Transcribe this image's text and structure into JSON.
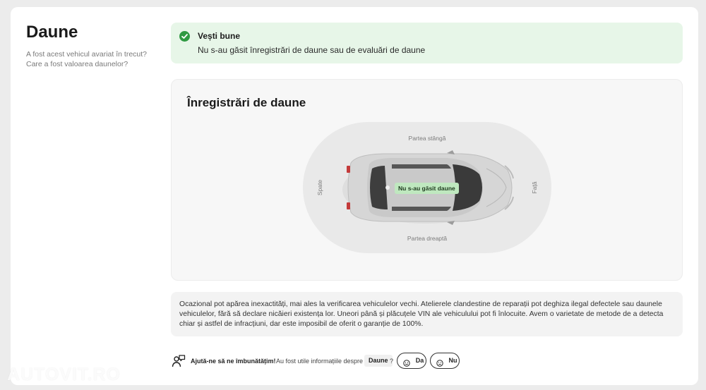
{
  "sidebar": {
    "title": "Daune",
    "subtitle": "A fost acest vehicul avariat în trecut? Care a fost valoarea daunelor?"
  },
  "good_news": {
    "title": "Vești bune",
    "text": "Nu s-au găsit înregistrări de daune sau de evaluări de daune",
    "icon": "check-circle-icon",
    "accent_color": "#2f9a42",
    "background_color": "#e7f6e8"
  },
  "records": {
    "title": "Înregistrări de daune",
    "labels": {
      "left": "Partea stângă",
      "right": "Partea dreaptă",
      "rear": "Spate",
      "front": "Față"
    },
    "badge": "Nu s-au găsit daune",
    "badge_color": "#bfe8bf"
  },
  "disclaimer": {
    "text": "Ocazional pot apărea inexactități, mai ales la verificarea vehiculelor vechi. Atelierele clandestine de reparații pot deghiza ilegal defectele sau daunele vehiculelor, fără să declare nicăieri existența lor. Uneori până și plăcuțele VIN ale vehiculului pot fi înlocuite. Avem o varietate de metode de a detecta chiar și astfel de infracțiuni, dar este imposibil de oferit o garanție de 100%."
  },
  "feedback": {
    "icon": "feedback-people-icon",
    "title": "Ajută-ne să ne îmbunătățim!",
    "question": "Au fost utile informațiile despre",
    "topic": "Daune",
    "question_mark": "?",
    "yes_label": "Da",
    "no_label": "Nu",
    "yes_icon": "happy-face-icon",
    "no_icon": "sad-face-icon"
  },
  "watermark": "AUTOVIT.RO"
}
